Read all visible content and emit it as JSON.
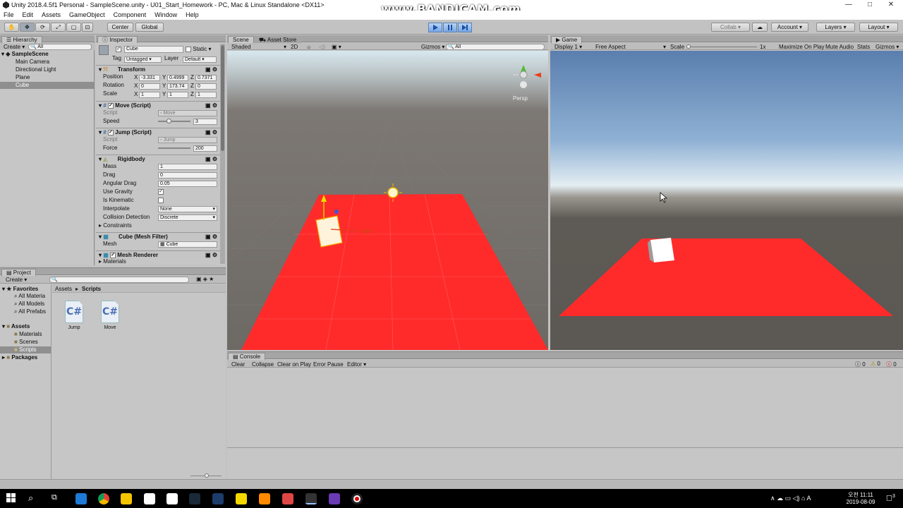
{
  "window": {
    "title": "Unity 2018.4.5f1 Personal - SampleScene.unity - U01_Start_Homework - PC, Mac & Linux Standalone <DX11>",
    "watermark": "www.BANDICAM.com"
  },
  "menu": [
    "File",
    "Edit",
    "Assets",
    "GameObject",
    "Component",
    "Window",
    "Help"
  ],
  "toolbar": {
    "center": "Center",
    "global": "Global",
    "collab": "Collab",
    "account": "Account",
    "layers": "Layers",
    "layout": "Layout"
  },
  "hierarchy": {
    "tab": "Hierarchy",
    "create": "Create",
    "search_placeholder": "All",
    "scene": "SampleScene",
    "items": [
      "Main Camera",
      "Directional Light",
      "Plane",
      "Cube"
    ]
  },
  "inspector": {
    "tab": "Inspector",
    "name": "Cube",
    "static": "Static",
    "tag_label": "Tag",
    "tag": "Untagged",
    "layer_label": "Layer",
    "layer": "Default",
    "transform": {
      "title": "Transform",
      "position": "Position",
      "rotation": "Rotation",
      "scale": "Scale",
      "px": "-3.331",
      "py": "0.4999",
      "pz": "0.7371",
      "rx": "0",
      "ry": "173.74",
      "rz": "0",
      "sx": "1",
      "sy": "1",
      "sz": "1"
    },
    "move": {
      "title": "Move (Script)",
      "script_label": "Script",
      "script": "Move",
      "speed_label": "Speed",
      "speed": "3"
    },
    "jump": {
      "title": "Jump (Script)",
      "script_label": "Script",
      "script": "Jump",
      "force_label": "Force",
      "force": "200"
    },
    "rigidbody": {
      "title": "Rigidbody",
      "mass_label": "Mass",
      "mass": "1",
      "drag_label": "Drag",
      "drag": "0",
      "angular_label": "Angular Drag",
      "angular": "0.05",
      "gravity_label": "Use Gravity",
      "kinematic_label": "Is Kinematic",
      "interp_label": "Interpolate",
      "interp": "None",
      "collision_label": "Collision Detection",
      "collision": "Discrete",
      "constraints": "Constraints"
    },
    "meshfilter": {
      "title": "Cube (Mesh Filter)",
      "mesh_label": "Mesh",
      "mesh": "Cube"
    },
    "meshrenderer": {
      "title": "Mesh Renderer",
      "materials": "Materials"
    }
  },
  "scene": {
    "tab": "Scene",
    "tab2": "Asset Store",
    "shaded": "Shaded",
    "twod": "2D",
    "gizmos": "Gizmos",
    "search": "All",
    "persp": "Persp"
  },
  "game": {
    "tab": "Game",
    "display": "Display 1",
    "aspect": "Free Aspect",
    "scale_label": "Scale",
    "scale": "1x",
    "maximize": "Maximize On Play",
    "mute": "Mute Audio",
    "stats": "Stats",
    "gizmos": "Gizmos"
  },
  "project": {
    "tab": "Project",
    "create": "Create",
    "favorites": "Favorites",
    "fav_items": [
      "All Materia",
      "All Models",
      "All Prefabs"
    ],
    "assets": "Assets",
    "asset_items": [
      "Materials",
      "Scenes",
      "Scripts"
    ],
    "packages": "Packages",
    "path_assets": "Assets",
    "path_scripts": "Scripts",
    "files": [
      {
        "icon": "C#",
        "name": "Jump"
      },
      {
        "icon": "C#",
        "name": "Move"
      }
    ]
  },
  "console": {
    "tab": "Console",
    "buttons": [
      "Clear",
      "Collapse",
      "Clear on Play",
      "Error Pause",
      "Editor"
    ],
    "counts": [
      "0",
      "0",
      "0"
    ]
  },
  "tray": {
    "time": "오전 11:11",
    "date": "2019-08-09",
    "badge": "3"
  },
  "colors": {
    "plane": "#ff2b2b",
    "editor_bg": "#c2c2c2",
    "play_blue": "#77a7e6"
  }
}
